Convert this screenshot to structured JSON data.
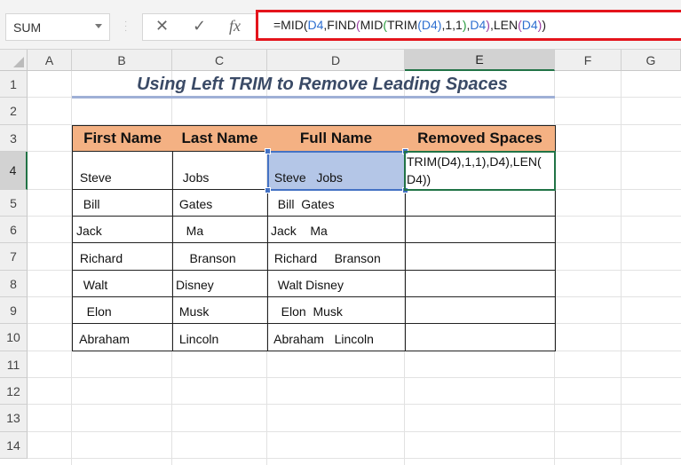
{
  "formula_bar": {
    "name_box": "SUM",
    "cancel_icon": "✕",
    "enter_icon": "✓",
    "fx_icon": "fx",
    "formula_parts": [
      {
        "t": "=MID(",
        "c": ""
      },
      {
        "t": "D4",
        "c": "b"
      },
      {
        "t": ",FIND",
        "c": ""
      },
      {
        "t": "(",
        "c": "p1"
      },
      {
        "t": "MID",
        "c": ""
      },
      {
        "t": "(",
        "c": "p2"
      },
      {
        "t": "TRIM",
        "c": ""
      },
      {
        "t": "(",
        "c": "p3"
      },
      {
        "t": "D4",
        "c": "b"
      },
      {
        "t": ")",
        "c": "p3"
      },
      {
        "t": ",1,1",
        "c": ""
      },
      {
        "t": ")",
        "c": "p2"
      },
      {
        "t": ",",
        "c": ""
      },
      {
        "t": "D4",
        "c": "b"
      },
      {
        "t": ")",
        "c": "p1"
      },
      {
        "t": ",LEN",
        "c": ""
      },
      {
        "t": "(",
        "c": "p1"
      },
      {
        "t": "D4",
        "c": "b"
      },
      {
        "t": ")",
        "c": "p1"
      },
      {
        "t": ")",
        "c": ""
      }
    ]
  },
  "columns": [
    "A",
    "B",
    "C",
    "D",
    "E",
    "F",
    "G"
  ],
  "selected_column": "E",
  "rows": [
    "1",
    "2",
    "3",
    "4",
    "5",
    "6",
    "7",
    "8",
    "9",
    "10",
    "11",
    "12",
    "13",
    "14"
  ],
  "selected_row": "4",
  "sheet": {
    "title": "Using Left TRIM to Remove Leading Spaces",
    "table": {
      "headers": [
        "First Name",
        "Last Name",
        "Full Name",
        "Removed Spaces"
      ],
      "rows": [
        {
          "first": " Steve",
          "last": "  Jobs",
          "full": " Steve   Jobs",
          "removed": ""
        },
        {
          "first": "  Bill",
          "last": " Gates",
          "full": "  Bill  Gates",
          "removed": ""
        },
        {
          "first": "Jack",
          "last": "   Ma",
          "full": "Jack    Ma",
          "removed": ""
        },
        {
          "first": " Richard",
          "last": "    Branson",
          "full": " Richard     Branson",
          "removed": ""
        },
        {
          "first": "  Walt",
          "last": "Disney",
          "full": "  Walt Disney",
          "removed": ""
        },
        {
          "first": "   Elon",
          "last": " Musk",
          "full": "   Elon  Musk",
          "removed": ""
        },
        {
          "first": " Abraham",
          "last": " Lincoln",
          "full": " Abraham   Lincoln",
          "removed": ""
        }
      ]
    },
    "editing_cell_text": "TRIM(D4),1,1),D4),LEN(\nD4))"
  }
}
